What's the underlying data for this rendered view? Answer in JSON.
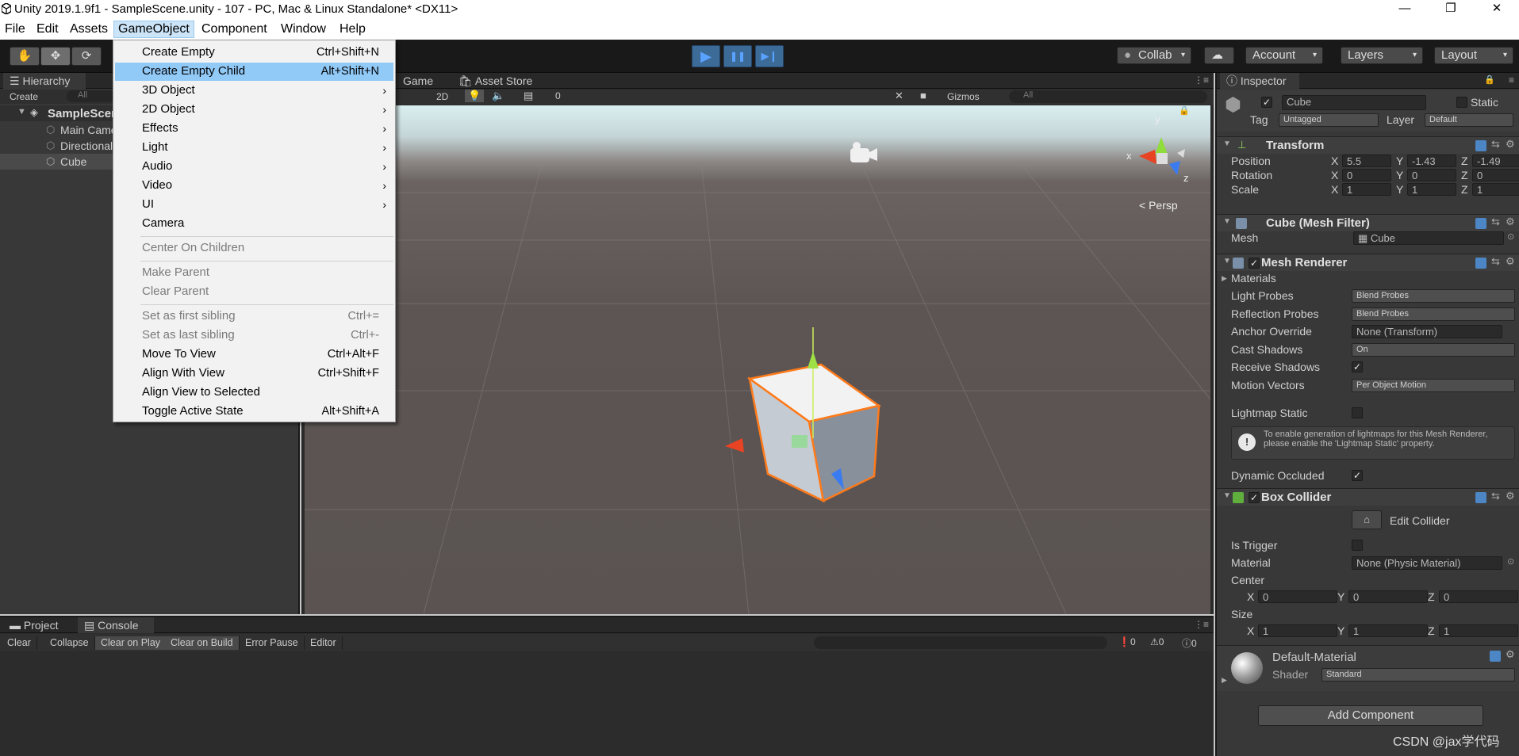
{
  "window": {
    "title": "Unity 2019.1.9f1 - SampleScene.unity - 107 - PC, Mac & Linux Standalone* <DX11>",
    "min": "—",
    "max": "❐",
    "close": "✕"
  },
  "menubar": [
    "File",
    "Edit",
    "Assets",
    "GameObject",
    "Component",
    "Window",
    "Help"
  ],
  "toolbar": {
    "collab": "Collab",
    "account": "Account",
    "layers": "Layers",
    "layout": "Layout",
    "dd_arrow": "▾",
    "play": "▶",
    "pause": "❚❚",
    "step": "▶❙"
  },
  "gameobject_menu": [
    {
      "label": "Create Empty",
      "shortcut": "Ctrl+Shift+N",
      "enabled": true
    },
    {
      "label": "Create Empty Child",
      "shortcut": "Alt+Shift+N",
      "enabled": true,
      "highlight": true
    },
    {
      "label": "3D Object",
      "submenu": true,
      "enabled": true
    },
    {
      "label": "2D Object",
      "submenu": true,
      "enabled": true
    },
    {
      "label": "Effects",
      "submenu": true,
      "enabled": true
    },
    {
      "label": "Light",
      "submenu": true,
      "enabled": true
    },
    {
      "label": "Audio",
      "submenu": true,
      "enabled": true
    },
    {
      "label": "Video",
      "submenu": true,
      "enabled": true
    },
    {
      "label": "UI",
      "submenu": true,
      "enabled": true
    },
    {
      "label": "Camera",
      "enabled": true
    },
    {
      "sep": true
    },
    {
      "label": "Center On Children",
      "enabled": false
    },
    {
      "sep": true
    },
    {
      "label": "Make Parent",
      "enabled": false
    },
    {
      "label": "Clear Parent",
      "enabled": false
    },
    {
      "sep": true
    },
    {
      "label": "Set as first sibling",
      "shortcut": "Ctrl+=",
      "enabled": false
    },
    {
      "label": "Set as last sibling",
      "shortcut": "Ctrl+-",
      "enabled": false
    },
    {
      "label": "Move To View",
      "shortcut": "Ctrl+Alt+F",
      "enabled": true
    },
    {
      "label": "Align With View",
      "shortcut": "Ctrl+Shift+F",
      "enabled": true
    },
    {
      "label": "Align View to Selected",
      "enabled": true
    },
    {
      "label": "Toggle Active State",
      "shortcut": "Alt+Shift+A",
      "enabled": true
    }
  ],
  "hierarchy": {
    "tab": "Hierarchy",
    "create": "Create",
    "search": "All",
    "scene": "SampleScene",
    "items": [
      "Main Camera",
      "Directional Light",
      "Cube"
    ]
  },
  "scene": {
    "tabs": [
      "Game",
      "Asset Store"
    ],
    "mode2d": "2D",
    "gizmos": "Gizmos",
    "search": "All",
    "fxcount": "0",
    "persp": "Persp",
    "axis": {
      "x": "x",
      "y": "y",
      "z": "z"
    }
  },
  "inspector": {
    "tab": "Inspector",
    "object": "Cube",
    "static": "Static",
    "tag_label": "Tag",
    "tag": "Untagged",
    "layer_label": "Layer",
    "layer": "Default",
    "transform": {
      "name": "Transform",
      "rows": [
        {
          "label": "Position",
          "x": "5.5",
          "y": "-1.43",
          "z": "-1.49"
        },
        {
          "label": "Rotation",
          "x": "0",
          "y": "0",
          "z": "0"
        },
        {
          "label": "Scale",
          "x": "1",
          "y": "1",
          "z": "1"
        }
      ]
    },
    "axes": [
      "X",
      "Y",
      "Z"
    ],
    "meshfilter": {
      "name": "Cube (Mesh Filter)",
      "mesh_label": "Mesh",
      "mesh": "Cube"
    },
    "meshrenderer": {
      "name": "Mesh Renderer",
      "materials": "Materials",
      "rows": [
        {
          "label": "Light Probes",
          "value": "Blend Probes"
        },
        {
          "label": "Reflection Probes",
          "value": "Blend Probes"
        },
        {
          "label": "Anchor Override",
          "value": "None (Transform)"
        },
        {
          "label": "Cast Shadows",
          "value": "On"
        },
        {
          "label": "Receive Shadows"
        },
        {
          "label": "Motion Vectors",
          "value": "Per Object Motion"
        }
      ],
      "lightmap": "Lightmap Static",
      "info": "To enable generation of lightmaps for this Mesh Renderer, please enable the 'Lightmap Static' property.",
      "dynamic": "Dynamic Occluded"
    },
    "boxcollider": {
      "name": "Box Collider",
      "edit": "Edit Collider",
      "trigger": "Is Trigger",
      "material_label": "Material",
      "material": "None (Physic Material)",
      "center_label": "Center",
      "center": {
        "x": "0",
        "y": "0",
        "z": "0"
      },
      "size_label": "Size",
      "size": {
        "x": "1",
        "y": "1",
        "z": "1"
      }
    },
    "material": {
      "name": "Default-Material",
      "shader_label": "Shader",
      "shader": "Standard"
    },
    "add": "Add Component"
  },
  "bottom": {
    "tabs": [
      "Project",
      "Console"
    ],
    "buttons": [
      "Clear",
      "Collapse",
      "Clear on Play",
      "Clear on Build",
      "Error Pause",
      "Editor"
    ],
    "counts": [
      "0",
      "0",
      "0"
    ]
  },
  "watermark": "CSDN @jax学代码"
}
